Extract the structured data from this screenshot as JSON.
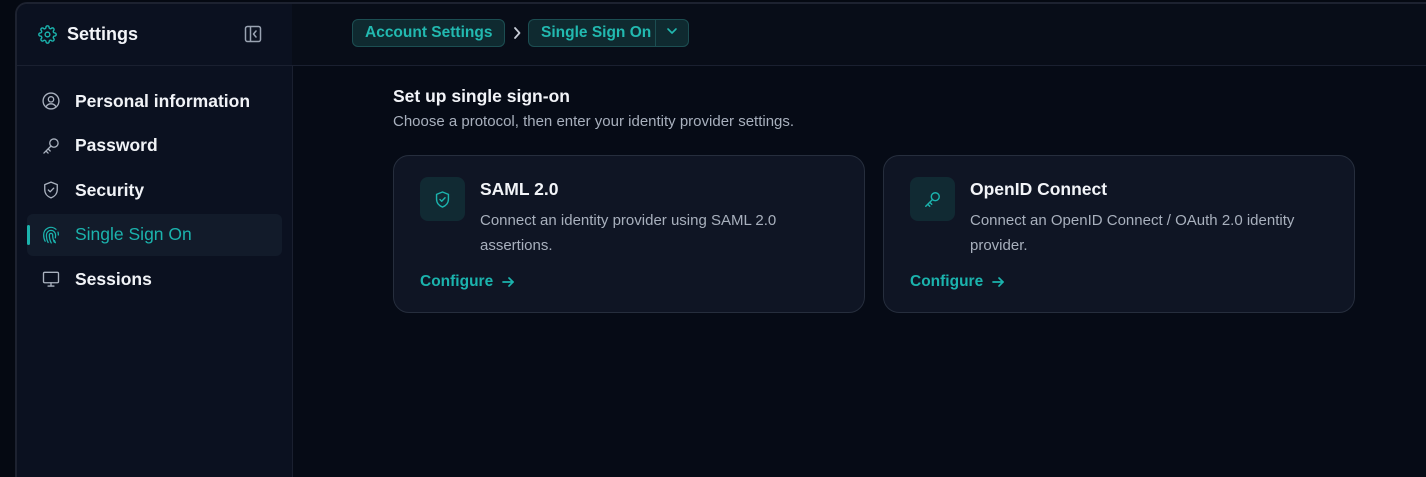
{
  "sidebar": {
    "title": "Settings",
    "items": [
      {
        "label": "Personal information",
        "icon": "user-circle-icon"
      },
      {
        "label": "Password",
        "icon": "key-icon"
      },
      {
        "label": "Security",
        "icon": "shield-icon"
      },
      {
        "label": "Single Sign On",
        "icon": "fingerprint-icon",
        "active": true
      },
      {
        "label": "Sessions",
        "icon": "monitor-icon"
      }
    ]
  },
  "breadcrumb": {
    "parent": "Account Settings",
    "current": "Single Sign On"
  },
  "main": {
    "title": "Set up single sign-on",
    "subtitle": "Choose a protocol, then enter your identity provider settings.",
    "cards": [
      {
        "title": "SAML 2.0",
        "description": "Connect an identity provider using SAML 2.0 assertions.",
        "link": "Configure",
        "icon": "shield-check-icon"
      },
      {
        "title": "OpenID Connect",
        "description": "Connect an OpenID Connect / OAuth 2.0 identity provider.",
        "link": "Configure",
        "icon": "key-icon"
      }
    ]
  },
  "colors": {
    "accent": "#1bb3ad",
    "background": "#060b16",
    "sidebar": "#0b1120",
    "card": "#0f1524"
  }
}
